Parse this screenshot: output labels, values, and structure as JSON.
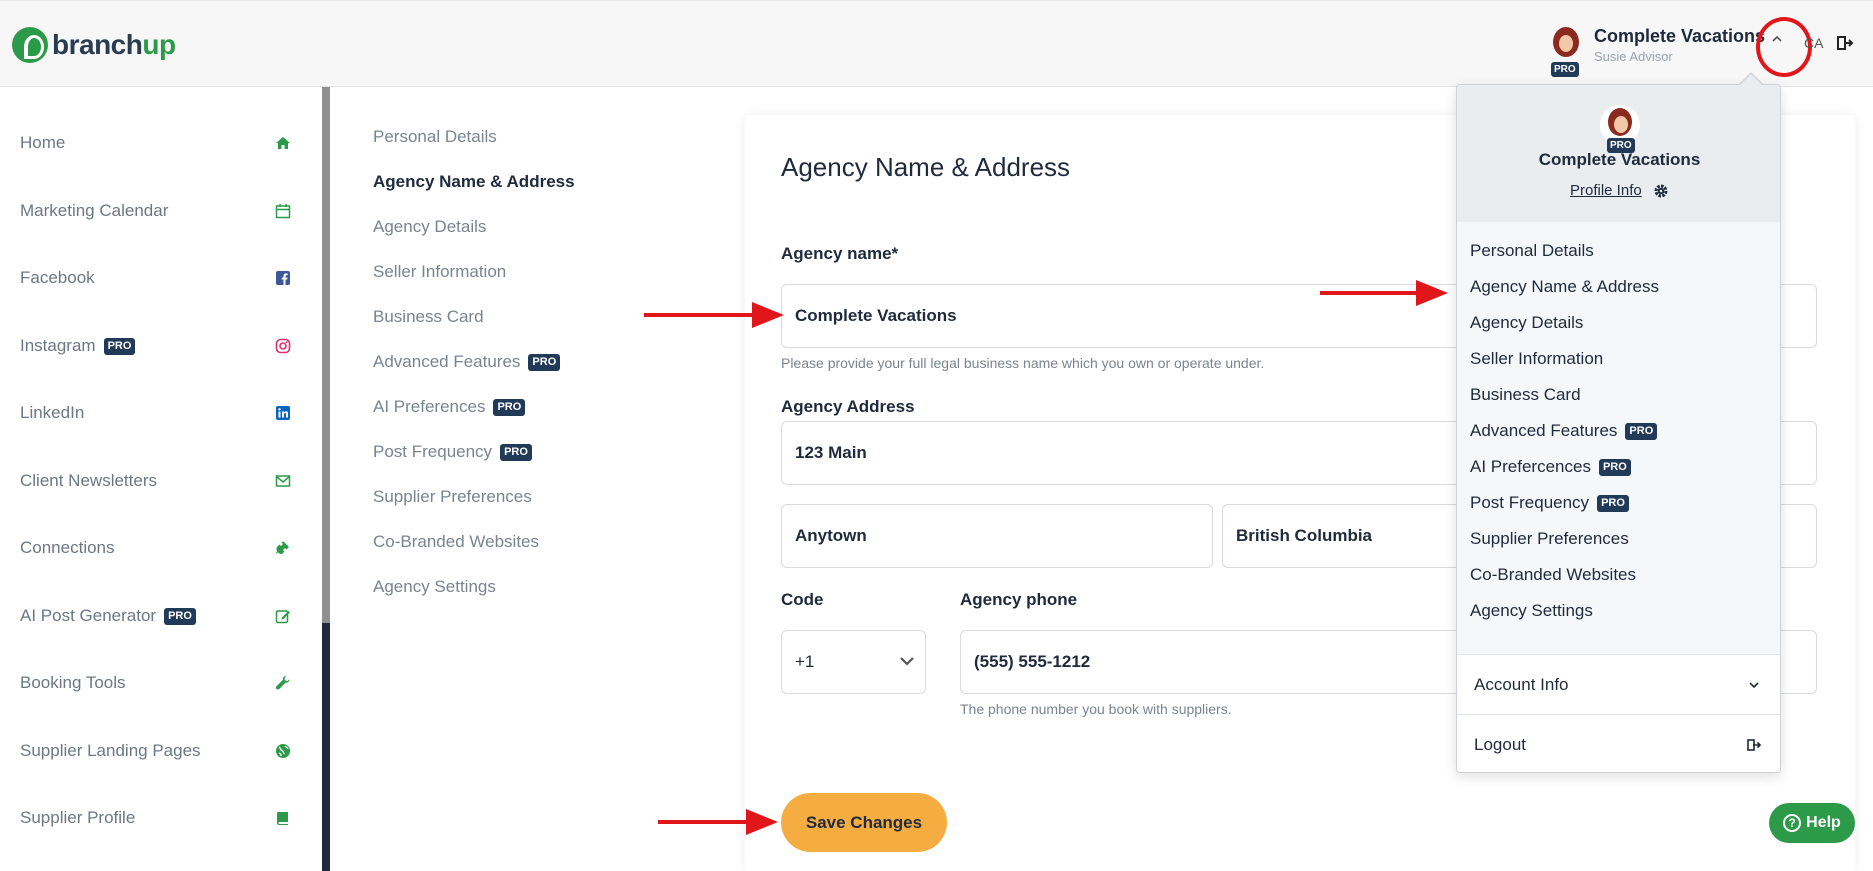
{
  "brand": {
    "logo_part1": "branch",
    "logo_part2": "up"
  },
  "header": {
    "account_name": "Complete Vacations",
    "user_name": "Susie Advisor",
    "pro_badge": "PRO",
    "lang": "CA"
  },
  "sidebar": {
    "items": [
      {
        "label": "Home",
        "icon": "home-icon",
        "pro": ""
      },
      {
        "label": "Marketing Calendar",
        "icon": "calendar-icon",
        "pro": ""
      },
      {
        "label": "Facebook",
        "icon": "facebook-icon",
        "pro": ""
      },
      {
        "label": "Instagram",
        "icon": "instagram-icon",
        "pro": "PRO"
      },
      {
        "label": "LinkedIn",
        "icon": "linkedin-icon",
        "pro": ""
      },
      {
        "label": "Client Newsletters",
        "icon": "envelope-icon",
        "pro": ""
      },
      {
        "label": "Connections",
        "icon": "plug-icon",
        "pro": ""
      },
      {
        "label": "AI Post Generator",
        "icon": "edit-icon",
        "pro": "PRO"
      },
      {
        "label": "Booking Tools",
        "icon": "wrench-icon",
        "pro": ""
      },
      {
        "label": "Supplier Landing Pages",
        "icon": "globe-icon",
        "pro": ""
      },
      {
        "label": "Supplier Profile",
        "icon": "book-icon",
        "pro": ""
      }
    ]
  },
  "settings_nav": {
    "items": [
      {
        "label": "Personal Details",
        "pro": ""
      },
      {
        "label": "Agency Name & Address",
        "pro": ""
      },
      {
        "label": "Agency Details",
        "pro": ""
      },
      {
        "label": "Seller Information",
        "pro": ""
      },
      {
        "label": "Business Card",
        "pro": ""
      },
      {
        "label": "Advanced Features",
        "pro": "PRO"
      },
      {
        "label": "AI Preferences",
        "pro": "PRO"
      },
      {
        "label": "Post Frequency",
        "pro": "PRO"
      },
      {
        "label": "Supplier Preferences",
        "pro": ""
      },
      {
        "label": "Co-Branded Websites",
        "pro": ""
      },
      {
        "label": "Agency Settings",
        "pro": ""
      }
    ],
    "active": "Agency Name & Address"
  },
  "form": {
    "title": "Agency Name & Address",
    "agency_name_label": "Agency name*",
    "agency_name_value": "Complete Vacations",
    "agency_name_help": "Please provide your full legal business name which you own or operate under.",
    "address_label": "Agency Address",
    "address_line": "123 Main",
    "city": "Anytown",
    "province": "British Columbia",
    "code_label": "Code",
    "code_value": "+1",
    "phone_label": "Agency phone",
    "phone_value": "(555) 555-1212",
    "phone_help": "The phone number you book with suppliers.",
    "save_label": "Save Changes"
  },
  "help": {
    "label": "Help"
  },
  "dropdown": {
    "name": "Complete Vacations",
    "pro_badge": "PRO",
    "profile_link": "Profile Info",
    "items": [
      {
        "label": "Personal Details",
        "pro": ""
      },
      {
        "label": "Agency Name & Address",
        "pro": ""
      },
      {
        "label": "Agency Details",
        "pro": ""
      },
      {
        "label": "Seller Information",
        "pro": ""
      },
      {
        "label": "Business Card",
        "pro": ""
      },
      {
        "label": "Advanced Features",
        "pro": "PRO"
      },
      {
        "label": "AI Prefercences",
        "pro": "PRO"
      },
      {
        "label": "Post Frequency",
        "pro": "PRO"
      },
      {
        "label": "Supplier Preferences",
        "pro": ""
      },
      {
        "label": "Co-Branded Websites",
        "pro": ""
      },
      {
        "label": "Agency Settings",
        "pro": ""
      }
    ],
    "account_info": "Account Info",
    "logout": "Logout"
  },
  "colors": {
    "brand_green": "#2c9a49",
    "pro_navy": "#213a57",
    "save_orange": "#f5ad42",
    "annotation_red": "#e0161b"
  }
}
